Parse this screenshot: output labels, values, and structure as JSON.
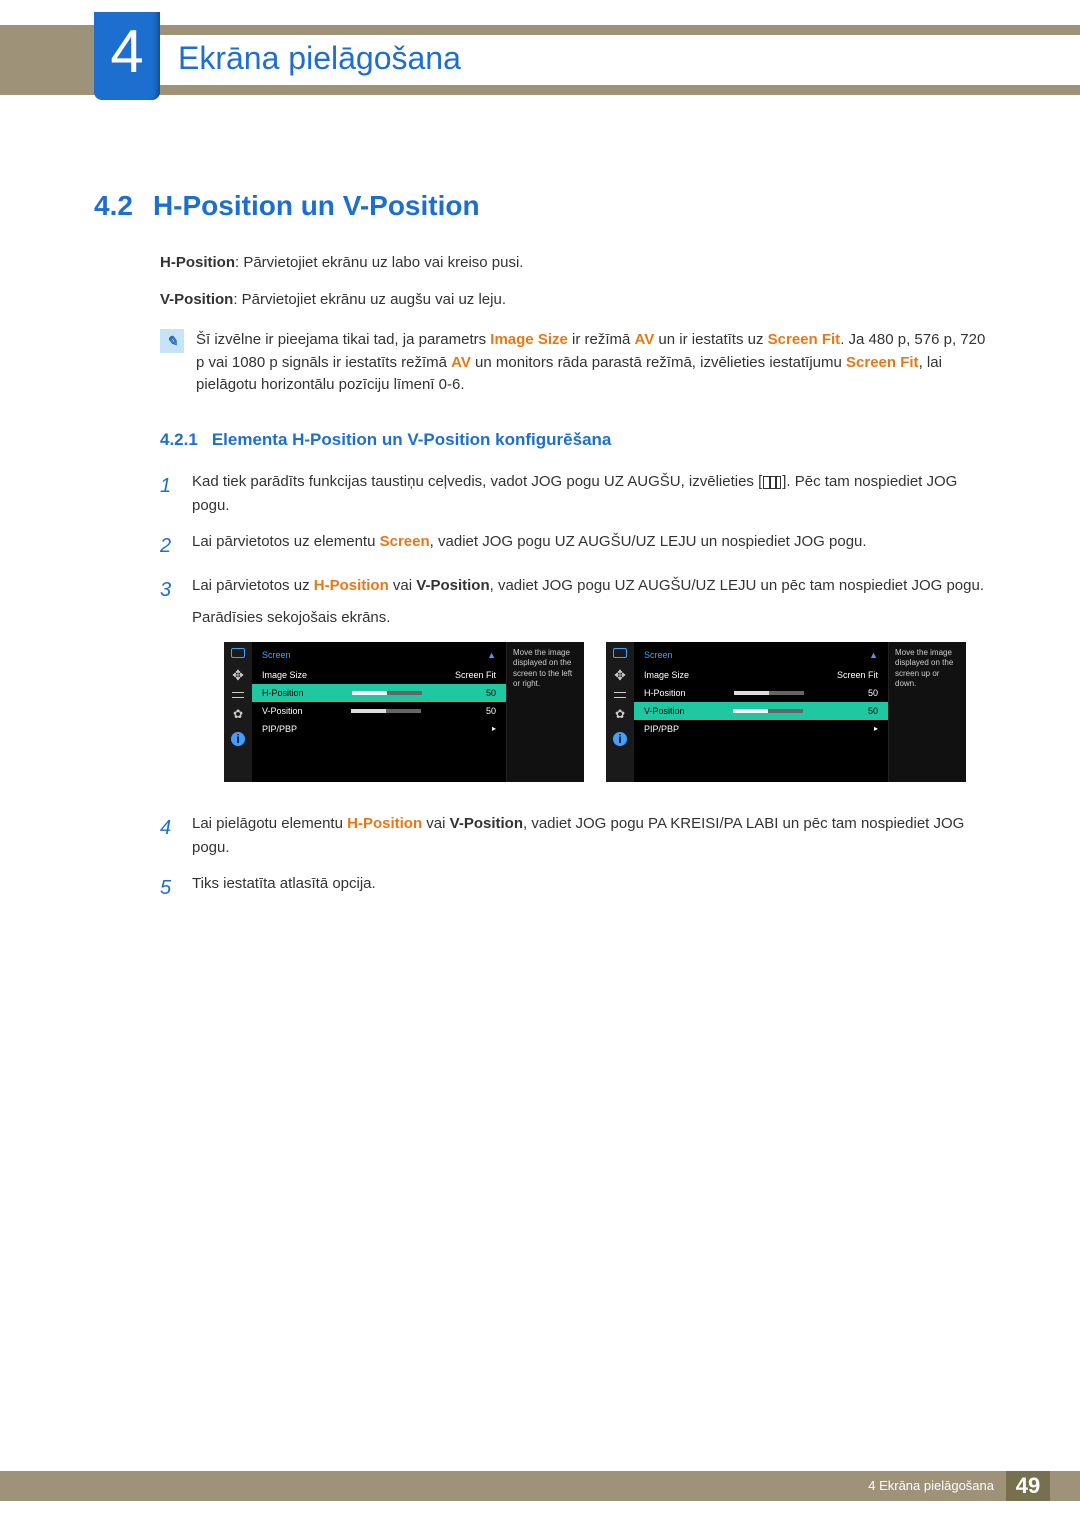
{
  "chapter": {
    "number": "4",
    "title": "Ekrāna pielāgošana"
  },
  "section": {
    "number": "4.2",
    "title": "H-Position un V-Position"
  },
  "intro": {
    "hpos_label": "H-Position",
    "hpos_text": ": Pārvietojiet ekrānu uz labo vai kreiso pusi.",
    "vpos_label": "V-Position",
    "vpos_text": ": Pārvietojiet ekrānu uz augšu vai uz leju."
  },
  "note": {
    "part1": "Šī izvēlne ir pieejama tikai tad, ja parametrs ",
    "image_size": "Image Size",
    "part2": " ir režīmā ",
    "av": "AV",
    "part3": " un ir iestatīts uz ",
    "screen_fit": "Screen Fit",
    "part4": ". Ja 480 p, 576 p, 720 p vai 1080 p signāls ir iestatīts režīmā ",
    "part5": " un monitors rāda parastā režīmā, izvēlieties iestatījumu ",
    "part6": ", lai pielāgotu horizontālu pozīciju līmenī 0-6."
  },
  "subsection": {
    "number": "4.2.1",
    "title": "Elementa H-Position un V-Position konfigurēšana"
  },
  "steps": {
    "s1a": "Kad tiek parādīts funkcijas taustiņu ceļvedis, vadot JOG pogu UZ AUGŠU, izvēlieties [",
    "s1b": "]. Pēc tam nospiediet JOG pogu.",
    "s2a": "Lai pārvietotos uz elementu ",
    "s2_screen": "Screen",
    "s2b": ", vadiet JOG pogu UZ AUGŠU/UZ LEJU un nospiediet JOG pogu.",
    "s3a": "Lai pārvietotos uz ",
    "s3_h": "H-Position",
    "s3_or": " vai ",
    "s3_v": "V-Position",
    "s3b": ", vadiet JOG pogu UZ AUGŠU/UZ LEJU un pēc tam nospiediet JOG pogu.",
    "s3c": "Parādīsies sekojošais ekrāns.",
    "s4a": "Lai pielāgotu elementu ",
    "s4b": ", vadiet JOG pogu PA KREISI/PA LABI un pēc tam nospiediet JOG pogu.",
    "s5": "Tiks iestatīta atlasītā opcija."
  },
  "osd": {
    "title": "Screen",
    "arrow_up": "▲",
    "image_size": "Image Size",
    "screen_fit": "Screen Fit",
    "hpos": "H-Position",
    "vpos": "V-Position",
    "val50": "50",
    "pipbp": "PIP/PBP",
    "arrow_right": "▸",
    "tip_left": "Move the image displayed on the screen to the left or right.",
    "tip_right": "Move the image displayed on the screen up or down."
  },
  "footer": {
    "text": "4 Ekrāna pielāgošana",
    "page": "49"
  }
}
